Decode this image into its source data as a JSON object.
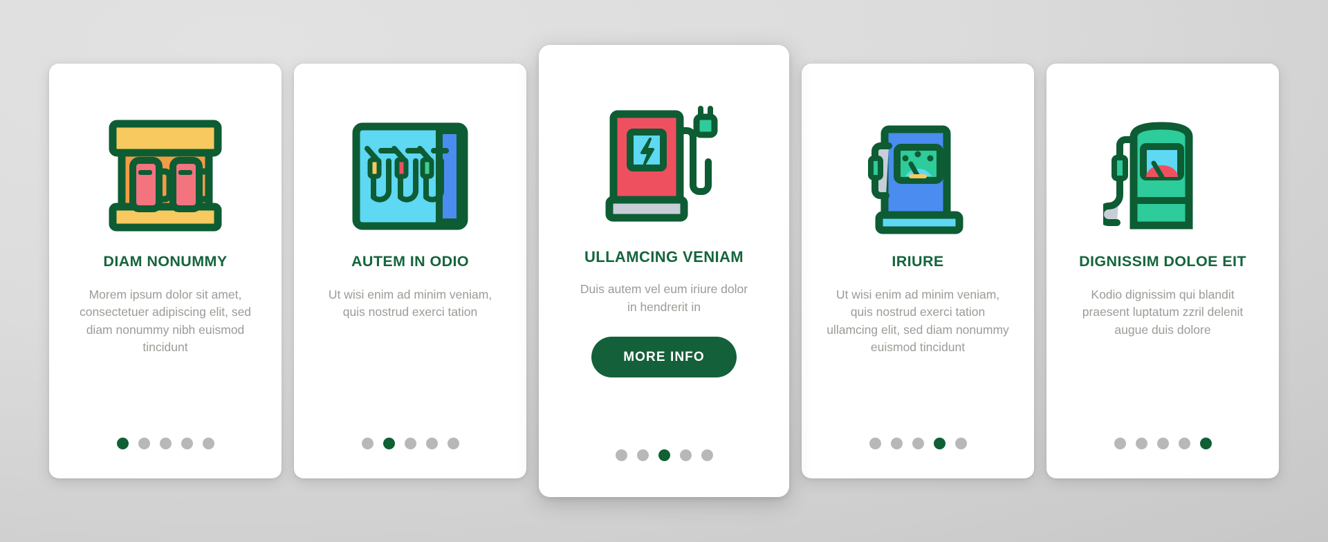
{
  "palette": {
    "background_light": "#e2e2e2",
    "background_dark": "#bdbdbd",
    "card_bg": "#ffffff",
    "title_green": "#15653c",
    "body_grey": "#9b9b96",
    "dot_inactive": "#b8b8b8",
    "dot_active": "#0f6033",
    "button_green": "#14603a",
    "outline_green": "#0d5c33",
    "yellow": "#f7c95f",
    "orange": "#f49b45",
    "red": "#ef5060",
    "pink": "#f3737f",
    "cyan": "#5ed8f3",
    "blue": "#4a8cf0",
    "teal": "#2ecb9b",
    "green_mint": "#3ecf93",
    "grey_base": "#c8ced8"
  },
  "cards": [
    {
      "icon": "gas-station-canopy-icon",
      "title": "DIAM NONUMMY",
      "body": "Morem ipsum dolor sit amet, consectetuer adipiscing elit, sed diam nonummy nibh euismod tincidunt",
      "dots": {
        "count": 5,
        "active_index": 0
      },
      "featured": false,
      "cta": null
    },
    {
      "icon": "fuel-nozzles-row-icon",
      "title": "AUTEM IN ODIO",
      "body": "Ut wisi enim ad minim veniam, quis nostrud exerci tation",
      "dots": {
        "count": 5,
        "active_index": 1
      },
      "featured": false,
      "cta": null
    },
    {
      "icon": "ev-charging-station-icon",
      "title": "ULLAMCING VENIAM",
      "body": "Duis autem vel eum iriure dolor in hendrerit in",
      "dots": {
        "count": 5,
        "active_index": 2
      },
      "featured": true,
      "cta": "MORE INFO"
    },
    {
      "icon": "fuel-pump-gauge-blue-icon",
      "title": "IRIURE",
      "body": "Ut wisi enim ad minim veniam, quis nostrud exerci tation ullamcing elit, sed diam nonummy euismod tincidunt",
      "dots": {
        "count": 5,
        "active_index": 3
      },
      "featured": false,
      "cta": null
    },
    {
      "icon": "fuel-pump-gauge-green-icon",
      "title": "DIGNISSIM DOLOE EIT",
      "body": "Kodio dignissim qui blandit praesent luptatum zzril delenit augue duis dolore",
      "dots": {
        "count": 5,
        "active_index": 4
      },
      "featured": false,
      "cta": null
    }
  ]
}
